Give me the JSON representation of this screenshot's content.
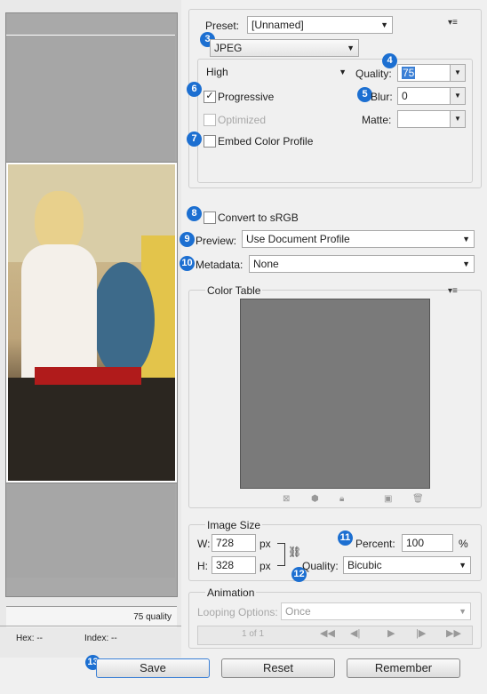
{
  "preview": {
    "quality_caption": "75 quality"
  },
  "status": {
    "hex": "Hex: --",
    "index": "Index: --"
  },
  "preset": {
    "label": "Preset:",
    "value": "[Unnamed]"
  },
  "format": {
    "value": "JPEG",
    "badge": "3"
  },
  "quality": {
    "level": "High",
    "label": "Quality:",
    "value": "75",
    "badge": "4"
  },
  "progressive": {
    "label": "Progressive",
    "checked": true,
    "badge": "6"
  },
  "blur": {
    "label": "Blur:",
    "value": "0",
    "badge": "5"
  },
  "optimized": {
    "label": "Optimized"
  },
  "matte": {
    "label": "Matte:",
    "value": ""
  },
  "embed": {
    "label": "Embed Color Profile",
    "badge": "7"
  },
  "convert": {
    "label": "Convert to sRGB",
    "badge": "8"
  },
  "preview_opt": {
    "label": "Preview:",
    "value": "Use Document Profile",
    "badge": "9"
  },
  "metadata": {
    "label": "Metadata:",
    "value": "None",
    "badge": "10"
  },
  "color_table": {
    "title": "Color Table",
    "swatch_color": "#7a7a7a"
  },
  "image_size": {
    "title": "Image Size",
    "w_label": "W:",
    "w_value": "728",
    "w_unit": "px",
    "h_label": "H:",
    "h_value": "328",
    "h_unit": "px",
    "percent_label": "Percent:",
    "percent_value": "100",
    "percent_unit": "%",
    "quality_label": "Quality:",
    "quality_value": "Bicubic",
    "badge_percent": "11",
    "badge_quality": "12"
  },
  "animation": {
    "title": "Animation",
    "looping_label": "Looping Options:",
    "looping_value": "Once",
    "frame_counter": "1 of 1"
  },
  "buttons": {
    "save": "Save",
    "reset": "Reset",
    "remember": "Remember",
    "save_badge": "13"
  },
  "colors": {
    "accent": "#1c6fd1",
    "selection": "#3a7fd5"
  }
}
